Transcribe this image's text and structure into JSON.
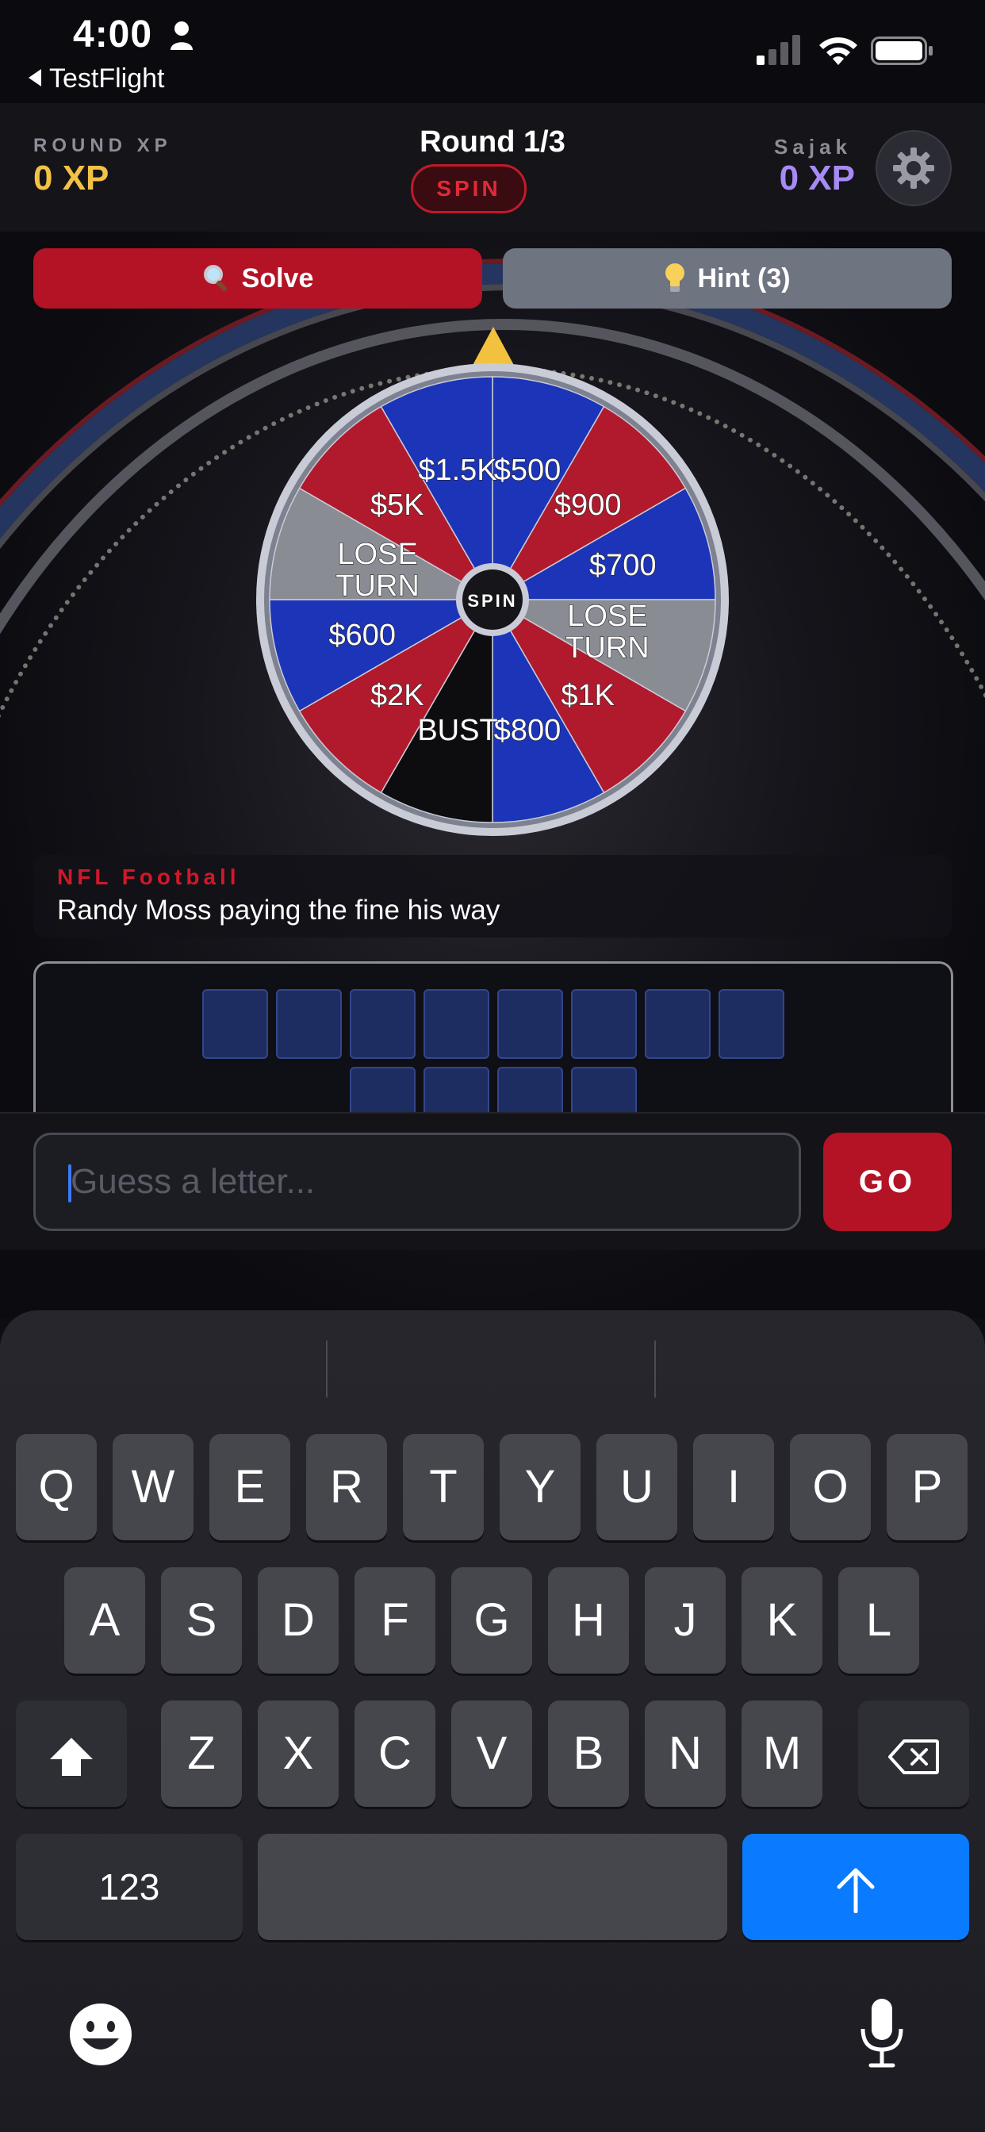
{
  "status_bar": {
    "time": "4:00",
    "back_label": "TestFlight"
  },
  "header": {
    "round_xp_label": "ROUND XP",
    "round_xp_value": "0 XP",
    "round_label": "Round 1/3",
    "spin_badge": "SPIN",
    "opponent_name": "Sajak",
    "opponent_xp_value": "0 XP"
  },
  "actions": {
    "solve_label": "Solve",
    "hint_label": "Hint (3)"
  },
  "wheel": {
    "center_label": "SPIN",
    "segments": [
      {
        "label": "$500",
        "color": "#1c34b8"
      },
      {
        "label": "$900",
        "color": "#b11a2c"
      },
      {
        "label": "$700",
        "color": "#1c34b8"
      },
      {
        "label": "LOSE TURN",
        "color": "#8a8c94"
      },
      {
        "label": "$1K",
        "color": "#b11a2c"
      },
      {
        "label": "$800",
        "color": "#1c34b8"
      },
      {
        "label": "BUST",
        "color": "#0d0d10"
      },
      {
        "label": "$2K",
        "color": "#b11a2c"
      },
      {
        "label": "$600",
        "color": "#1c34b8"
      },
      {
        "label": "LOSE TURN",
        "color": "#8a8c94"
      },
      {
        "label": "$5K",
        "color": "#b11a2c"
      },
      {
        "label": "$1.5K",
        "color": "#1c34b8"
      }
    ]
  },
  "clue": {
    "category": "NFL Football",
    "text": "Randy Moss paying the fine his way"
  },
  "puzzle": {
    "row_lengths": [
      8,
      4
    ]
  },
  "guess": {
    "placeholder": "Guess a letter...",
    "go_label": "GO"
  },
  "keyboard": {
    "row1": [
      "Q",
      "W",
      "E",
      "R",
      "T",
      "Y",
      "U",
      "I",
      "O",
      "P"
    ],
    "row2": [
      "A",
      "S",
      "D",
      "F",
      "G",
      "H",
      "J",
      "K",
      "L"
    ],
    "row3": [
      "Z",
      "X",
      "C",
      "V",
      "B",
      "N",
      "M"
    ],
    "numbers_label": "123"
  },
  "colors": {
    "accent_red": "#b31325",
    "xp_gold": "#f3c245",
    "xp_purple": "#a78af5",
    "keyboard_blue": "#0a7aff"
  }
}
